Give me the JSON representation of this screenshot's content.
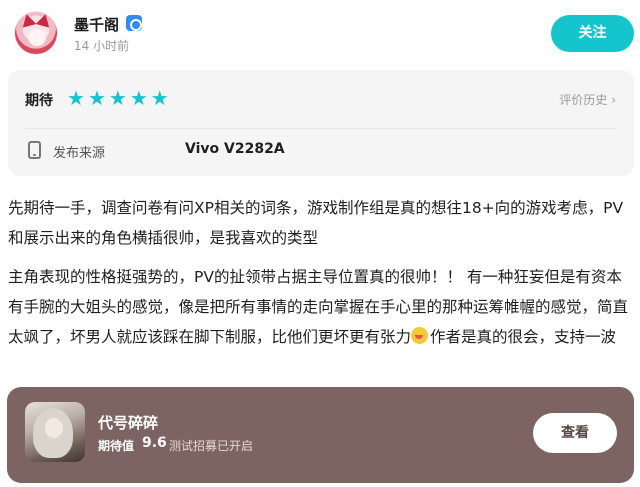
{
  "user": {
    "name": "墨千阁",
    "time": "14 小时前"
  },
  "header": {
    "follow_label": "关注"
  },
  "rating": {
    "label": "期待",
    "stars": 5,
    "star_color": "#15c5ce",
    "history_label": "评价历史 ›"
  },
  "device": {
    "label": "发布来源",
    "value": "Vivo V2282A"
  },
  "review": {
    "paragraph1": "先期待一手，调查问卷有问XP相关的词条，游戏制作组是真的想往18+向的游戏考虑，PV和展示出来的角色横插很帅，是我喜欢的类型",
    "paragraph2": "主角表现的性格挺强势的，PV的扯领带占据主导位置真的很帅！！ 有一种狂妄但是有资本有手腕的大姐头的感觉，像是把所有事情的走向掌握在手心里的那种运筹帷幄的感觉，简直太飒了，坏男人就应该踩在脚下制服，比他们更坏更有张力",
    "paragraph2_tail": "作者是真的很会，支持一波",
    "emoji": "laughing-emoji-icon"
  },
  "game": {
    "title": "代号碎碎",
    "expect_label": "期待值",
    "expect_score": "9.6",
    "status": "测试招募已开启",
    "view_label": "查看",
    "card_color": "#7d6462"
  }
}
